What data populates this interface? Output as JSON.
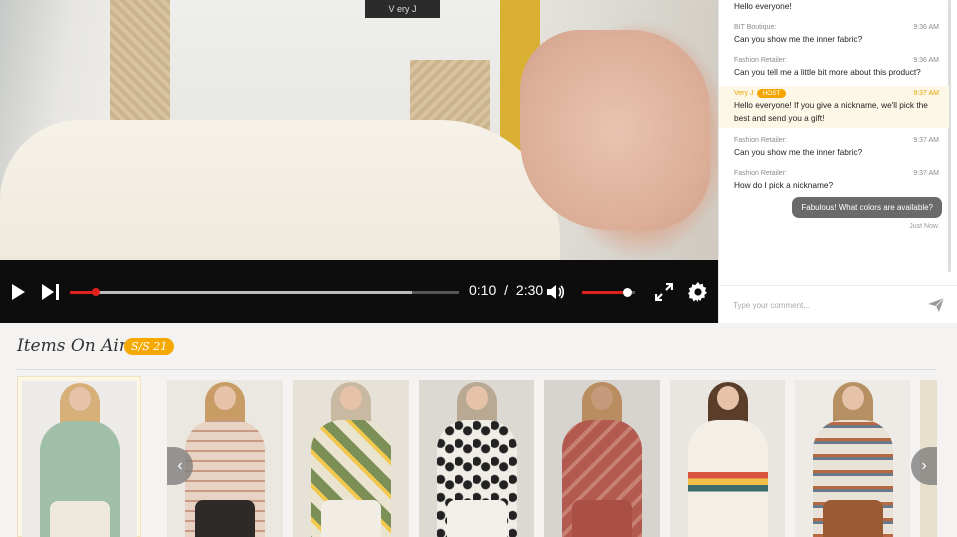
{
  "video": {
    "tag_text": "V ery J",
    "player": {
      "current_time": "0:10",
      "separator": "/",
      "duration": "2:30",
      "progress_fraction": 0.067,
      "buffered_fraction": 0.88,
      "volume_fraction": 0.85
    }
  },
  "chat": {
    "top_message": "Hello everyone!",
    "messages": [
      {
        "author": "BIT Boutique:",
        "time": "9:36 AM",
        "text": "Can you show me the inner fabric?",
        "host": false
      },
      {
        "author": "Fashion Retailer:",
        "time": "9:36 AM",
        "text": "Can you tell me a little bit more about this product?",
        "host": false
      },
      {
        "author": "Very J",
        "badge": "HOST",
        "time": "9:37 AM",
        "text": "Hello everyone! If you give a nickname, we'll pick the best and send you a gift!",
        "host": true
      },
      {
        "author": "Fashion Retailer:",
        "time": "9:37 AM",
        "text": "Can you show me the inner fabric?",
        "host": false
      },
      {
        "author": "Fashion Retailer:",
        "time": "9:37 AM",
        "text": "How do I pick a nickname?",
        "host": false
      }
    ],
    "my_message": "Fabulous! What colors are available?",
    "my_message_time": "Just Now",
    "input_placeholder": "Type your comment...",
    "icons": {
      "send": "send-icon"
    }
  },
  "items_section": {
    "title": "Items On Air",
    "badge": "S/S 21",
    "prev_arrow": "‹",
    "next_arrow": "›",
    "colors": {
      "accent": "#f5a800",
      "progress": "#e0221e",
      "host": "#e6a400"
    }
  }
}
